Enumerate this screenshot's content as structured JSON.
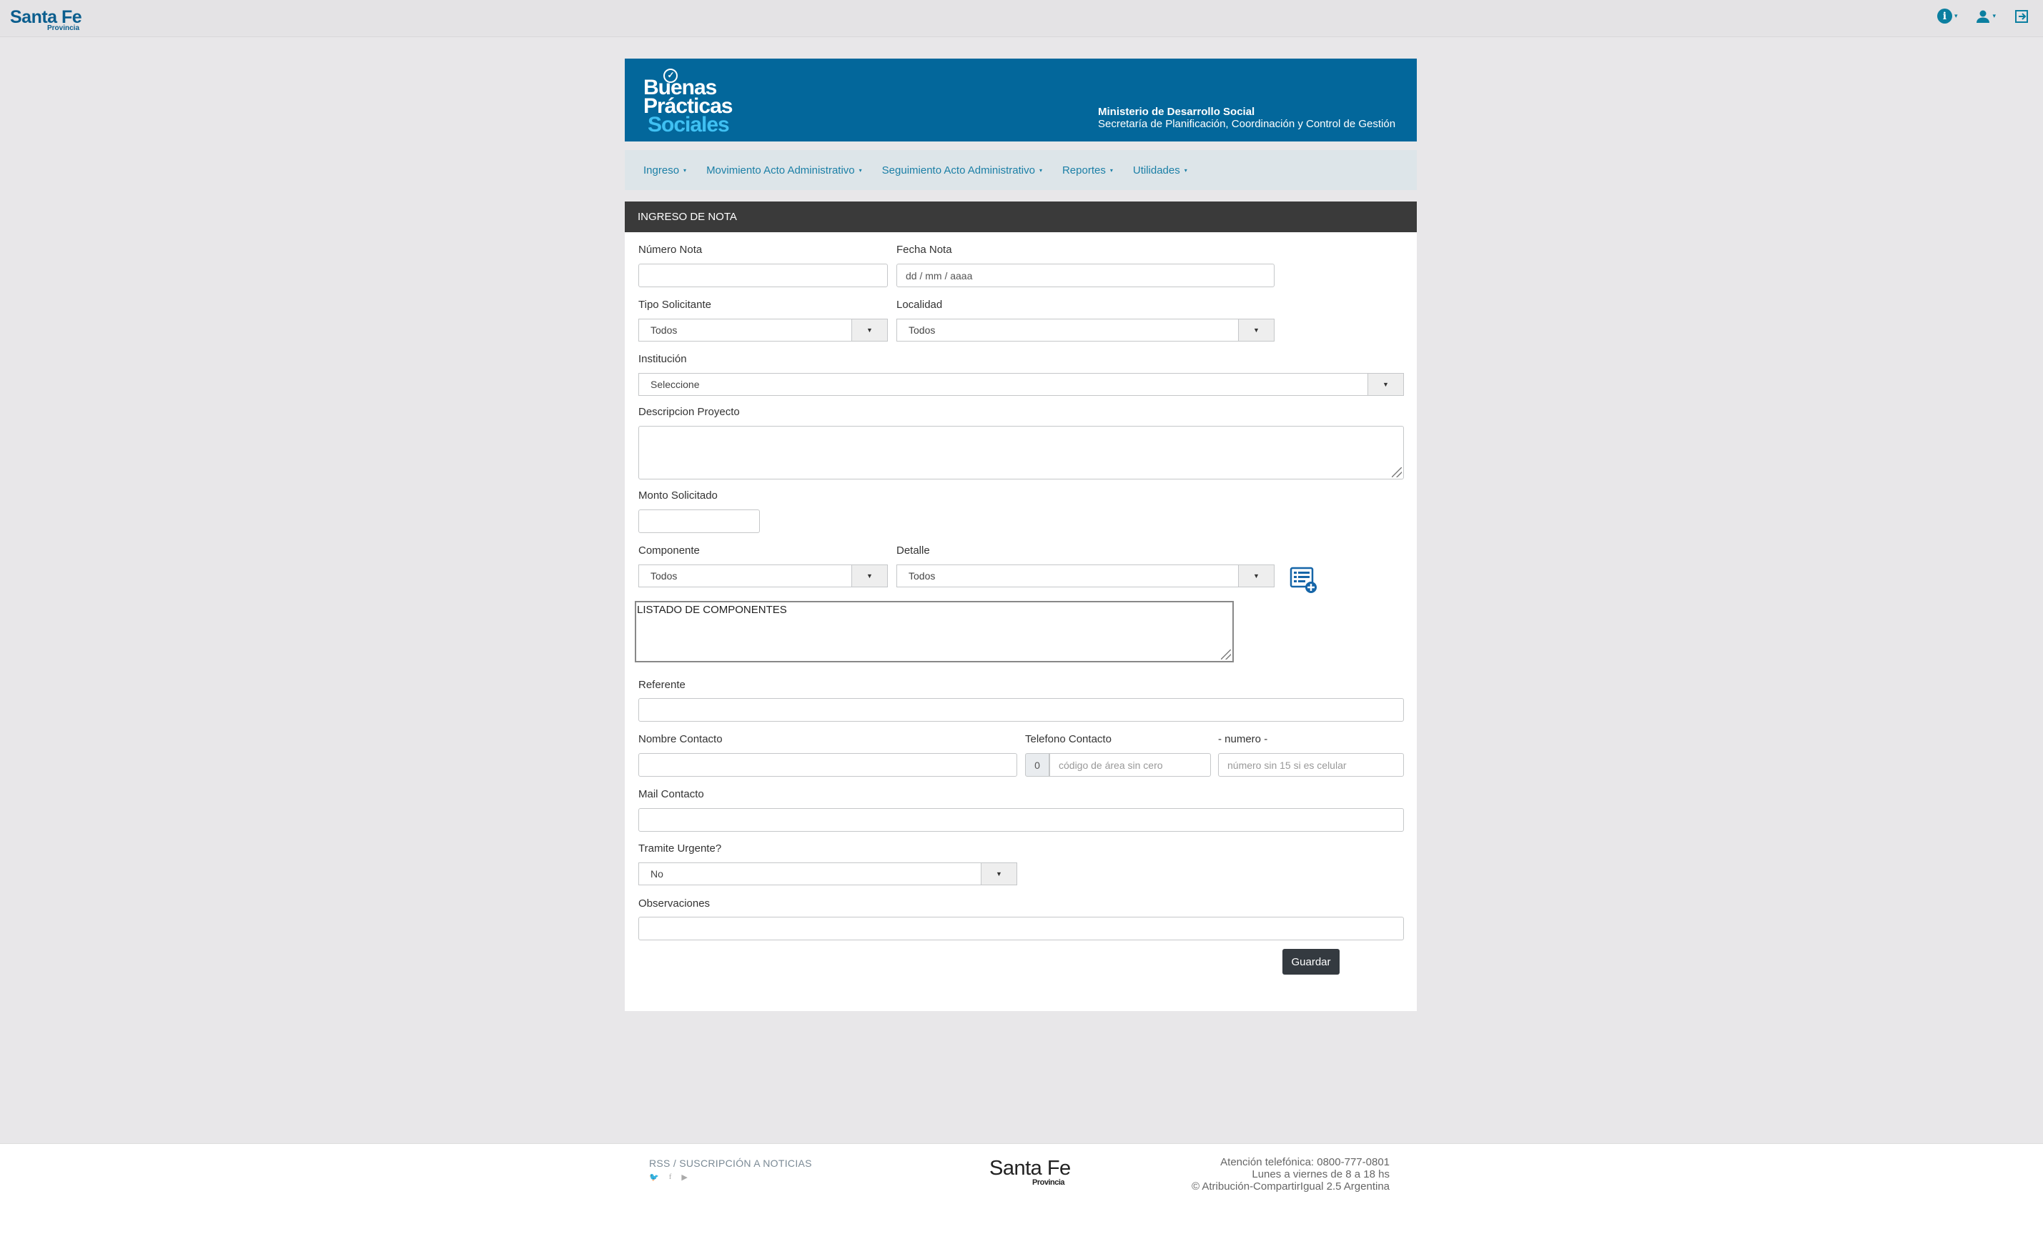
{
  "topbar": {
    "logo": "Santa Fe",
    "logo_sub": "Provincia",
    "icons": [
      "info-icon",
      "user-icon",
      "logout-icon"
    ]
  },
  "banner": {
    "brand_line1": "Buenas",
    "brand_line2": "Prácticas",
    "brand_line3": "Sociales",
    "ministry": "Ministerio de Desarrollo Social",
    "secretary": "Secretaría de Planificación, Coordinación y Control de Gestión"
  },
  "nav": {
    "items": [
      {
        "label": "Ingreso"
      },
      {
        "label": "Movimiento Acto Administrativo"
      },
      {
        "label": "Seguimiento Acto Administrativo"
      },
      {
        "label": "Reportes"
      },
      {
        "label": "Utilidades"
      }
    ]
  },
  "form": {
    "title": "INGRESO DE NOTA",
    "numero_nota": {
      "label": "Número Nota",
      "value": ""
    },
    "fecha_nota": {
      "label": "Fecha Nota",
      "placeholder": "dd / mm / aaaa"
    },
    "tipo_solicitante": {
      "label": "Tipo Solicitante",
      "value": "Todos"
    },
    "localidad": {
      "label": "Localidad",
      "value": "Todos"
    },
    "institucion": {
      "label": "Institución",
      "value": "Seleccione"
    },
    "descripcion": {
      "label": "Descripcion Proyecto",
      "value": ""
    },
    "monto": {
      "label": "Monto Solicitado",
      "value": ""
    },
    "componente": {
      "label": "Componente",
      "value": "Todos"
    },
    "detalle": {
      "label": "Detalle",
      "value": "Todos"
    },
    "listado": "LISTADO DE COMPONENTES",
    "referente": {
      "label": "Referente",
      "value": ""
    },
    "nombre_contacto": {
      "label": "Nombre Contacto",
      "value": ""
    },
    "telefono_contacto": {
      "label": "Telefono Contacto",
      "prefix": "0",
      "placeholder": "código de área sin cero"
    },
    "numero": {
      "label": "- numero -",
      "placeholder": "número sin 15 si es celular"
    },
    "mail_contacto": {
      "label": "Mail Contacto",
      "value": ""
    },
    "tramite_urgente": {
      "label": "Tramite Urgente?",
      "value": "No"
    },
    "observaciones": {
      "label": "Observaciones",
      "value": ""
    },
    "save_label": "Guardar"
  },
  "footer": {
    "rss": "RSS / SUSCRIPCIÓN A NOTICIAS",
    "logo": "Santa Fe",
    "logo_sub": "Provincia",
    "phone": "Atención telefónica: 0800-777-0801",
    "hours": "Lunes a viernes de 8 a 18 hs",
    "license": "© Atribución-CompartirIgual 2.5 Argentina"
  }
}
